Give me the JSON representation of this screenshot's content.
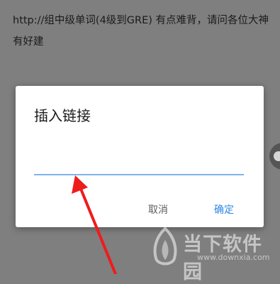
{
  "post": {
    "text": "http://组中级单词(4级到GRE) 有点难背，请问各位大神有好建"
  },
  "dialog": {
    "title": "插入链接",
    "input_value": "",
    "cancel_label": "取消",
    "confirm_label": "确定"
  },
  "watermark": {
    "brand": "当下软件园",
    "url": "www.downxia.com"
  },
  "colors": {
    "overlay": "#7f7f7f",
    "dialog_bg": "#ffffff",
    "accent": "#2e86e6",
    "input_underline": "#7fb3f0",
    "arrow": "#ee1c1c"
  }
}
